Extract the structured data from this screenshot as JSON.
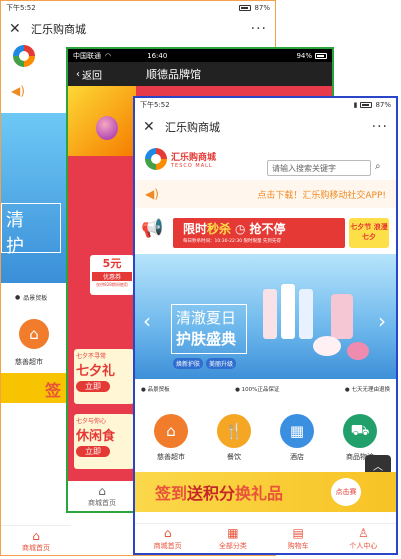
{
  "phone1": {
    "time": "下午5:52",
    "battery": "87%",
    "title": "汇乐购商城",
    "menu_dots": "···",
    "category": "清",
    "category2": "护",
    "shop_name": "品景贸板",
    "store_label": "慈善超市",
    "home_tab": "商城首页",
    "sign": "签"
  },
  "phone2": {
    "carrier": "中国联通",
    "time": "16:40",
    "battery": "94%",
    "back_label": "返回",
    "title": "顺德品牌馆",
    "promo_amount": "5元",
    "promo_sub": "优惠券",
    "promo_line": "仅供828期间使用",
    "sale1": "七夕不寻常",
    "sale1_big": "七夕礼",
    "sale1_btn": "立即",
    "sale2": "七夕与你心",
    "sale2_big": "休闲食",
    "sale2_btn": "立即",
    "home_tab": "商城首页"
  },
  "phone3": {
    "time": "下午5:52",
    "battery": "87%",
    "title": "汇乐购商城",
    "menu_dots": "···",
    "logo_cn": "汇乐购商城",
    "logo_en": "TESCO MALL",
    "search_placeholder": "请输入搜索关键字",
    "marquee": "点击下载！汇乐购移动社交APP!",
    "flash_title_a": "限时",
    "flash_title_b": "秒杀",
    "flash_title_c": "抢不停",
    "flash_sub": "每日秒杀时间：10:30-22:30 限时限量 先到先得",
    "flash_badge": "七夕节 浪漫七夕",
    "banner_title": "清澈夏日",
    "banner_title2": "护肤盛典",
    "banner_tag1": "焕新护肤",
    "banner_tag2": "美丽升级",
    "shops": [
      {
        "label": "品景贸板"
      },
      {
        "label": "100%正品保证"
      },
      {
        "label": "七天无理由退换"
      }
    ],
    "categories": [
      {
        "label": "慈善超市",
        "color": "#f07c2c",
        "icon": "home-icon"
      },
      {
        "label": "餐饮",
        "color": "#f5a623",
        "icon": "dining-icon"
      },
      {
        "label": "酒店",
        "color": "#3b8fe0",
        "icon": "hotel-icon"
      },
      {
        "label": "商品物流",
        "color": "#22a06b",
        "icon": "truck-icon"
      }
    ],
    "signin_a": "签到",
    "signin_b": "送积分",
    "signin_c": "换礼品",
    "signin_btn": "点击赛",
    "top_label": "顶部",
    "tabs": [
      {
        "label": "商城首页",
        "icon": "home-icon"
      },
      {
        "label": "全部分类",
        "icon": "grid-icon"
      },
      {
        "label": "购物车",
        "icon": "cart-icon"
      },
      {
        "label": "个人中心",
        "icon": "user-icon"
      }
    ]
  }
}
